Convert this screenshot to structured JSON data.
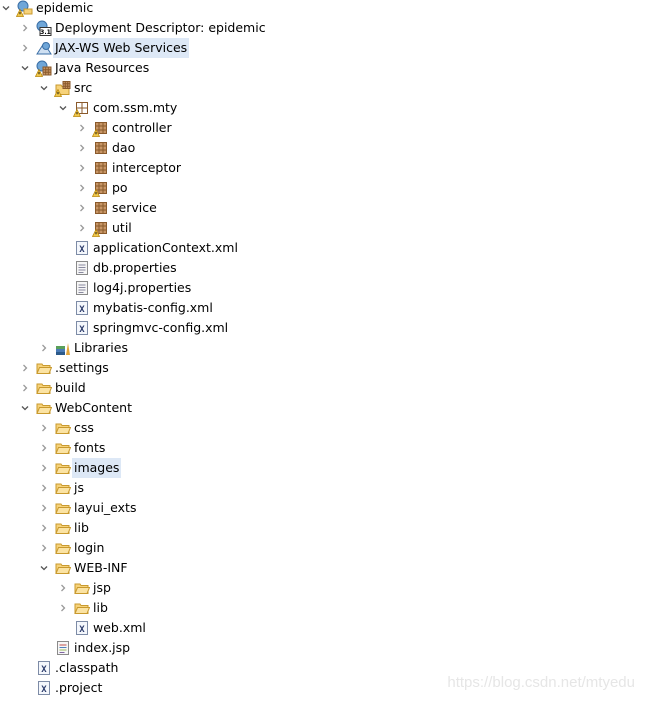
{
  "tree": [
    {
      "label": "epidemic",
      "level": 0,
      "expander": "expanded",
      "icon": "project-icon",
      "warning": true
    },
    {
      "label": "Deployment Descriptor: epidemic",
      "level": 1,
      "expander": "collapsed",
      "icon": "deployment-descriptor-icon"
    },
    {
      "label": "JAX-WS Web Services",
      "level": 1,
      "expander": "collapsed",
      "icon": "web-services-icon",
      "selected": true
    },
    {
      "label": "Java Resources",
      "level": 1,
      "expander": "expanded",
      "icon": "java-resources-icon",
      "warning": true
    },
    {
      "label": "src",
      "level": 2,
      "expander": "expanded",
      "icon": "source-folder-icon",
      "warning": true
    },
    {
      "label": "com.ssm.mty",
      "level": 3,
      "expander": "expanded",
      "icon": "empty-package-icon",
      "warning": true
    },
    {
      "label": "controller",
      "level": 4,
      "expander": "collapsed",
      "icon": "package-icon",
      "warning": true
    },
    {
      "label": "dao",
      "level": 4,
      "expander": "collapsed",
      "icon": "package-icon"
    },
    {
      "label": "interceptor",
      "level": 4,
      "expander": "collapsed",
      "icon": "package-icon"
    },
    {
      "label": "po",
      "level": 4,
      "expander": "collapsed",
      "icon": "package-icon",
      "warning": true
    },
    {
      "label": "service",
      "level": 4,
      "expander": "collapsed",
      "icon": "package-icon"
    },
    {
      "label": "util",
      "level": 4,
      "expander": "collapsed",
      "icon": "package-icon",
      "warning": true
    },
    {
      "label": "applicationContext.xml",
      "level": 4,
      "expander": "none",
      "icon": "xml-file-icon"
    },
    {
      "label": "db.properties",
      "level": 4,
      "expander": "none",
      "icon": "text-file-icon"
    },
    {
      "label": "log4j.properties",
      "level": 4,
      "expander": "none",
      "icon": "text-file-icon"
    },
    {
      "label": "mybatis-config.xml",
      "level": 4,
      "expander": "none",
      "icon": "xml-file-icon"
    },
    {
      "label": "springmvc-config.xml",
      "level": 4,
      "expander": "none",
      "icon": "xml-file-icon"
    },
    {
      "label": "Libraries",
      "level": 2,
      "expander": "collapsed",
      "icon": "libraries-icon"
    },
    {
      "label": ".settings",
      "level": 1,
      "expander": "collapsed",
      "icon": "folder-icon"
    },
    {
      "label": "build",
      "level": 1,
      "expander": "collapsed",
      "icon": "folder-icon"
    },
    {
      "label": "WebContent",
      "level": 1,
      "expander": "expanded",
      "icon": "folder-icon"
    },
    {
      "label": "css",
      "level": 2,
      "expander": "collapsed",
      "icon": "folder-icon"
    },
    {
      "label": "fonts",
      "level": 2,
      "expander": "collapsed",
      "icon": "folder-icon"
    },
    {
      "label": "images",
      "level": 2,
      "expander": "collapsed",
      "icon": "folder-icon",
      "selected": true
    },
    {
      "label": "js",
      "level": 2,
      "expander": "collapsed",
      "icon": "folder-icon"
    },
    {
      "label": "layui_exts",
      "level": 2,
      "expander": "collapsed",
      "icon": "folder-icon"
    },
    {
      "label": "lib",
      "level": 2,
      "expander": "collapsed",
      "icon": "folder-icon"
    },
    {
      "label": "login",
      "level": 2,
      "expander": "collapsed",
      "icon": "folder-icon"
    },
    {
      "label": "WEB-INF",
      "level": 2,
      "expander": "expanded",
      "icon": "folder-icon"
    },
    {
      "label": "jsp",
      "level": 3,
      "expander": "collapsed",
      "icon": "folder-icon"
    },
    {
      "label": "lib",
      "level": 3,
      "expander": "collapsed",
      "icon": "folder-icon"
    },
    {
      "label": "web.xml",
      "level": 4,
      "expander": "none",
      "icon": "xml-file-icon"
    },
    {
      "label": "index.jsp",
      "level": 3,
      "expander": "none",
      "icon": "jsp-file-icon"
    },
    {
      "label": ".classpath",
      "level": 2,
      "expander": "none",
      "icon": "xml-file-icon"
    },
    {
      "label": ".project",
      "level": 2,
      "expander": "none",
      "icon": "xml-file-icon"
    }
  ],
  "watermark": "https://blog.csdn.net/mtyedu",
  "colors": {
    "selection": "#dde8f6",
    "folder": "#e8b84a",
    "chevron": "#9a9a9a"
  }
}
